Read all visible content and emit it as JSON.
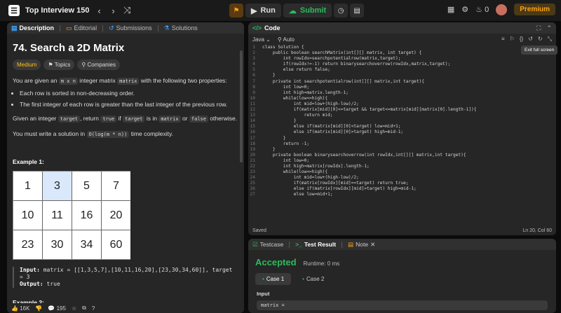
{
  "topbar": {
    "list_title": "Top Interview 150",
    "prev": "‹",
    "next": "›",
    "shuffle": "⤨",
    "run_label": "Run",
    "submit_label": "Submit",
    "streak_count": "0",
    "premium_label": "Premium"
  },
  "left_tabs": [
    {
      "label": "Description"
    },
    {
      "label": "Editorial"
    },
    {
      "label": "Submissions"
    },
    {
      "label": "Solutions"
    }
  ],
  "problem": {
    "title": "74. Search a 2D Matrix",
    "difficulty": "Medium",
    "topics_label": "Topics",
    "companies_label": "Companies",
    "p1_a": "You are given an ",
    "p1_code1": "m x n",
    "p1_b": " integer matrix ",
    "p1_code2": "matrix",
    "p1_c": " with the following two properties:",
    "bullet1": "Each row is sorted in non-decreasing order.",
    "bullet2": "The first integer of each row is greater than the last integer of the previous row.",
    "p2_a": "Given an integer ",
    "p2_code1": "target",
    "p2_b": ", return ",
    "p2_code2": "true",
    "p2_c": " if ",
    "p2_code3": "target",
    "p2_d": " is in ",
    "p2_code4": "matrix",
    "p2_e": " or ",
    "p2_code5": "false",
    "p2_f": " otherwise.",
    "p3_a": "You must write a solution in ",
    "p3_code": "O(log(m * n))",
    "p3_b": " time complexity.",
    "example1_title": "Example 1:",
    "matrix": [
      [
        "1",
        "3",
        "5",
        "7"
      ],
      [
        "10",
        "11",
        "16",
        "20"
      ],
      [
        "23",
        "30",
        "34",
        "60"
      ]
    ],
    "input_label": "Input:",
    "input_value": " matrix = [[1,3,5,7],[10,11,16,20],[23,30,34,60]], target = 3",
    "output_label": "Output:",
    "output_value": " true",
    "example2_title": "Example 2:"
  },
  "footer": {
    "likes": "16K",
    "comments": "195"
  },
  "code_panel": {
    "title": "Code",
    "language": "Java",
    "auto_label": "Auto",
    "status_left": "Saved",
    "status_right": "Ln 20, Col 60",
    "tooltip": "Exit full screen"
  },
  "code_lines": [
    {
      "n": "1",
      "t": "class Solution {"
    },
    {
      "n": "2",
      "t": "    public boolean searchMatrix(int[][] matrix, int target) {"
    },
    {
      "n": "3",
      "t": "        int rowIdx=searchpotentialrow(matrix,target);"
    },
    {
      "n": "4",
      "t": "        if(rowIdx!=-1) return binarysearchoverrow(rowIdx,matrix,target);"
    },
    {
      "n": "5",
      "t": "        else return false;"
    },
    {
      "n": "6",
      "t": "    }"
    },
    {
      "n": "7",
      "t": "    private int searchpotentialrow(int[][] matrix,int target){"
    },
    {
      "n": "8",
      "t": "        int low=0;"
    },
    {
      "n": "9",
      "t": "        int high=matrix.length-1;"
    },
    {
      "n": "10",
      "t": "        while(low<=high){"
    },
    {
      "n": "11",
      "t": "            int mid=low+(high-low)/2;"
    },
    {
      "n": "12",
      "t": "            if(matrix[mid][0]<=target && target<=matrix[mid][matrix[0].length-1]){"
    },
    {
      "n": "13",
      "t": "                return mid;"
    },
    {
      "n": "14",
      "t": "            }"
    },
    {
      "n": "15",
      "t": "            else if(matrix[mid][0]<target) low=mid+1;"
    },
    {
      "n": "16",
      "t": "            else if(matrix[mid][0]>target) high=mid-1;"
    },
    {
      "n": "17",
      "t": "        }"
    },
    {
      "n": "18",
      "t": "        return -1;"
    },
    {
      "n": "19",
      "t": "    }"
    },
    {
      "n": "20",
      "t": "    private boolean binarysearchoverrow(int rowIdx,int[][] matrix,int target){"
    },
    {
      "n": "21",
      "t": "        int low=0;"
    },
    {
      "n": "22",
      "t": "        int high=matrix[rowIdx].length-1;"
    },
    {
      "n": "23",
      "t": "        while(low<=high){"
    },
    {
      "n": "24",
      "t": "            int mid=low+(high-low)/2;"
    },
    {
      "n": "25",
      "t": "            if(matrix[rowIdx][mid]==target) return true;"
    },
    {
      "n": "26",
      "t": "            else if(matrix[rowIdx][mid]>target) high=mid-1;"
    },
    {
      "n": "27",
      "t": "            else low=mid+1;"
    }
  ],
  "test_panel": {
    "tab_testcase": "Testcase",
    "tab_result": "Test Result",
    "tab_note": "Note",
    "accepted": "Accepted",
    "runtime": "Runtime: 0 ms",
    "case1": "Case 1",
    "case2": "Case 2",
    "input_label": "Input",
    "input_value": "matrix ="
  }
}
